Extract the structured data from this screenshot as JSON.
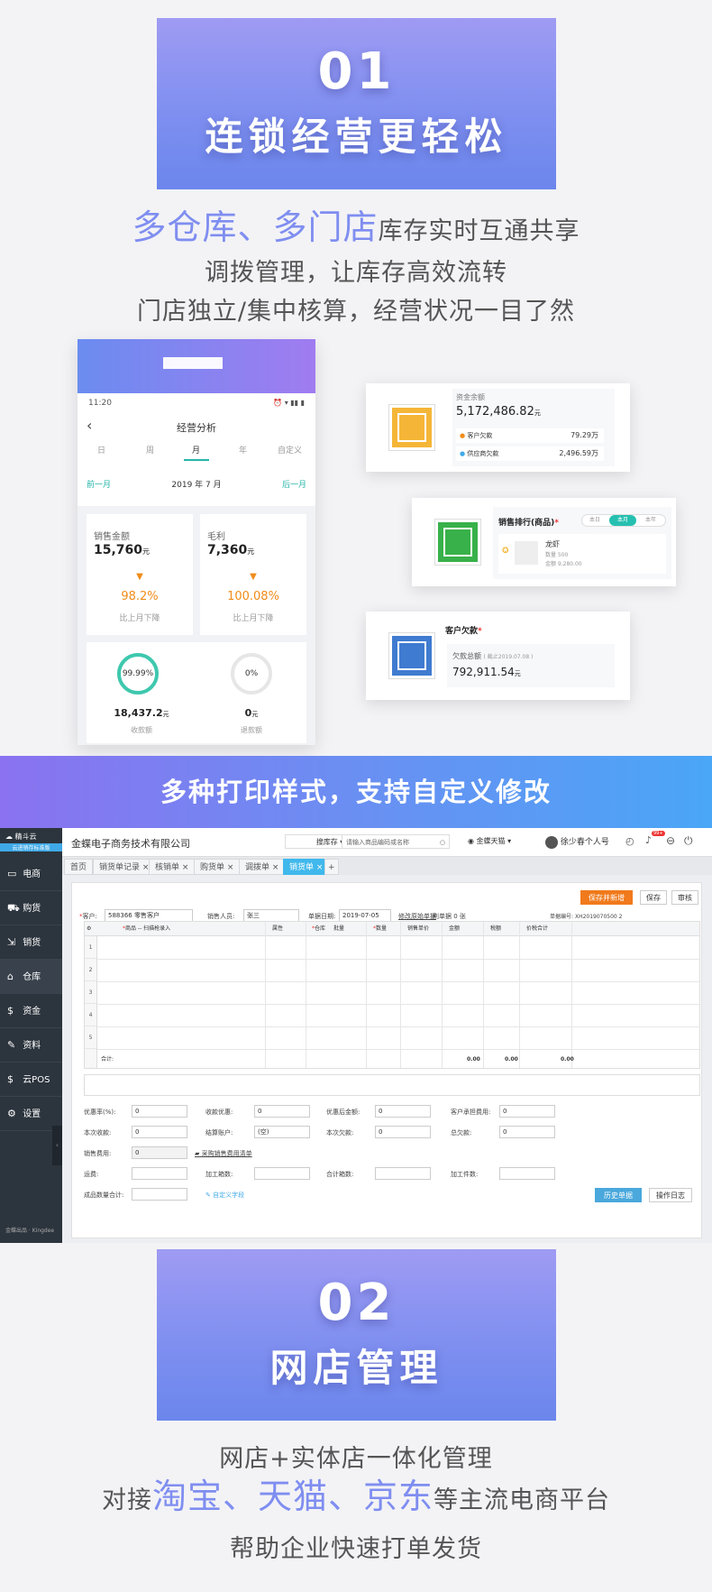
{
  "section1": {
    "num": "01",
    "title": "连锁经营更轻松",
    "line1_hl": "多仓库、多门店",
    "line1_rest": "库存实时互通共享",
    "line2": "调拨管理，让库存高效流转",
    "line3": "门店独立/集中核算，经营状况一目了然"
  },
  "phone": {
    "time": "11:20",
    "title": "经营分析",
    "tabs": [
      "日",
      "周",
      "月",
      "年",
      "自定义"
    ],
    "prev": "前一月",
    "date": "2019 年 7 月",
    "next": "后一月",
    "sales": {
      "label": "销售金额",
      "value": "15,760",
      "unit": "元",
      "pct": "98.2%",
      "cmp": "比上月下降"
    },
    "profit": {
      "label": "毛利",
      "value": "7,360",
      "unit": "元",
      "pct": "100.08%",
      "cmp": "比上月下降"
    },
    "recv": {
      "ring": "99.99%",
      "value": "18,437.2",
      "unit": "元",
      "label": "收款额",
      "ring_fill": 99.99
    },
    "refund": {
      "ring": "0%",
      "value": "0",
      "unit": "元",
      "label": "退款额",
      "ring_fill": 0
    }
  },
  "card1": {
    "title": "资金余额",
    "value": "5,172,486.82",
    "unit": "元",
    "r1_label": "客户欠款",
    "r1_val": "79.29",
    "r1_unit": "万",
    "r2_label": "供应商欠款",
    "r2_val": "2,496.59",
    "r2_unit": "万"
  },
  "card2": {
    "title": "销售排行(商品)",
    "tabs": [
      "本日",
      "本月",
      "本年"
    ],
    "item": "龙虾",
    "qty": "数量 500",
    "amt": "金额 9,280.00"
  },
  "card3": {
    "title": "客户欠款",
    "sub": "欠款总额",
    "note": "( 截止2019.07.08 )",
    "value": "792,911.54",
    "unit": "元"
  },
  "banner": "多种打印样式，支持自定义修改",
  "erp": {
    "logo": "精斗云",
    "logo_sub": "云进销存标准版",
    "company": "金蝶电子商务技术有限公司",
    "menu": [
      "电商",
      "购货",
      "销货",
      "仓库",
      "资金",
      "资料",
      "云POS",
      "设置"
    ],
    "search_type": "搜库存",
    "search_ph": "请输入商品编码或名称",
    "store": "金蝶天猫",
    "user": "徐少春个人号",
    "badge": "99+",
    "tabs": [
      "首页",
      "销货单记录",
      "核销单",
      "购货单",
      "调拨单",
      "销货单"
    ],
    "save_new": "保存并新增",
    "save": "保存",
    "audit": "审核",
    "cust_label": "客户:",
    "cust": "588366 零售客户",
    "seller_label": "销售人员:",
    "seller": "张三",
    "date_label": "单据日期:",
    "date": "2019-07-05",
    "link1": "修改原始单据",
    "link2": "判单据 0 张",
    "no_label": "单据编号:",
    "no": "XH2019070500 2",
    "cols": [
      "商品 -- 扫描枪录入",
      "属性",
      "仓库",
      "批量",
      "数量",
      "销售单价",
      "金额",
      "税额",
      "价税合计"
    ],
    "rows": [
      "1",
      "2",
      "3",
      "4",
      "5"
    ],
    "total_label": "合计:",
    "tot1": "0.00",
    "tot2": "0.00",
    "tot3": "0.00",
    "f": {
      "disc_rate": "优惠率(%):",
      "disc_rate_v": "0",
      "disc_amt": "收款优惠:",
      "disc_amt_v": "0",
      "after": "优惠后金额:",
      "after_v": "0",
      "cust_fee": "客户承担费用:",
      "cust_fee_v": "0",
      "recv": "本次收款:",
      "recv_v": "0",
      "acct": "结算账户:",
      "acct_v": "(空)",
      "owe": "本次欠款:",
      "owe_v": "0",
      "total_owe": "总欠款:",
      "total_owe_v": "0",
      "fee": "销售费用:",
      "fee_v": "0",
      "fee_link": "采购销售费用清单",
      "ship": "运费:",
      "proc_box": "加工箱数:",
      "count_box": "合计箱数:",
      "proc_piece": "加工件数:",
      "qty_total": "成品数量合计:",
      "custom": "自定义字段",
      "history": "历史单据",
      "log": "操作日志"
    },
    "footer": "金蝶出品 · Kingdee"
  },
  "section2": {
    "num": "02",
    "title": "网店管理",
    "line1": "网店+实体店一体化管理",
    "line2_pre": "对接",
    "line2_hl": "淘宝、天猫、京东",
    "line2_rest": "等主流电商平台",
    "line3": "帮助企业快速打单发货"
  }
}
